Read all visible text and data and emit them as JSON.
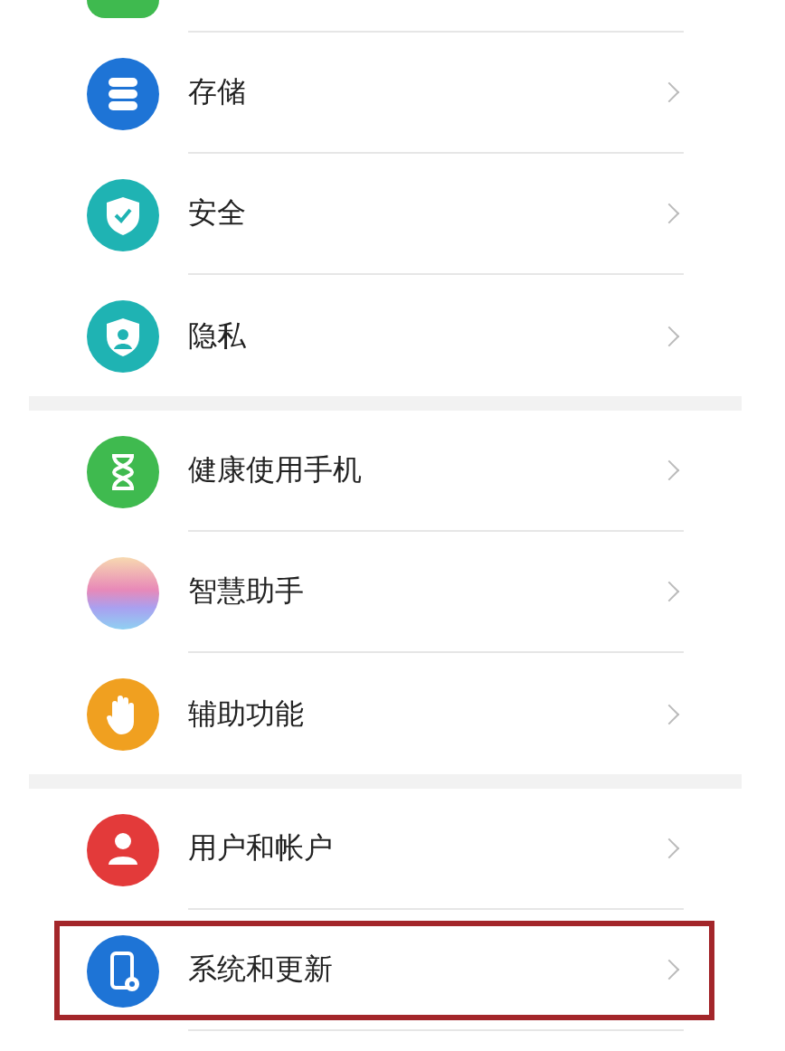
{
  "groups": [
    {
      "items": [
        {
          "label": "存储",
          "kind": "storage",
          "highlighted": false
        },
        {
          "label": "安全",
          "kind": "shield",
          "highlighted": false
        },
        {
          "label": "隐私",
          "kind": "privacy",
          "highlighted": false
        }
      ]
    },
    {
      "items": [
        {
          "label": "健康使用手机",
          "kind": "hourglass",
          "highlighted": false
        },
        {
          "label": "智慧助手",
          "kind": "orb",
          "highlighted": false
        },
        {
          "label": "辅助功能",
          "kind": "hand",
          "highlighted": false
        }
      ]
    },
    {
      "items": [
        {
          "label": "用户和帐户",
          "kind": "user",
          "highlighted": false
        },
        {
          "label": "系统和更新",
          "kind": "phone",
          "highlighted": true
        }
      ]
    }
  ]
}
